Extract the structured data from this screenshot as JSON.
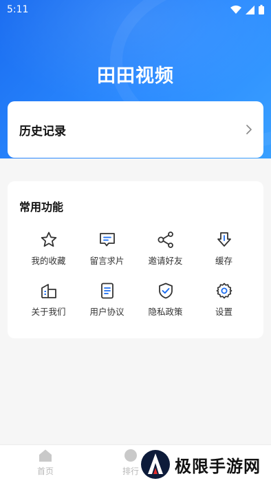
{
  "status_bar": {
    "time": "5:11"
  },
  "header": {
    "title": "田田视频"
  },
  "history": {
    "label": "历史记录"
  },
  "functions": {
    "title": "常用功能",
    "items": [
      {
        "label": "我的收藏",
        "icon": "star-icon"
      },
      {
        "label": "留言求片",
        "icon": "message-icon"
      },
      {
        "label": "邀请好友",
        "icon": "share-icon"
      },
      {
        "label": "缓存",
        "icon": "download-icon"
      },
      {
        "label": "关于我们",
        "icon": "building-icon"
      },
      {
        "label": "用户协议",
        "icon": "document-icon"
      },
      {
        "label": "隐私政策",
        "icon": "shield-check-icon"
      },
      {
        "label": "设置",
        "icon": "gear-icon"
      }
    ]
  },
  "tabbar": {
    "tabs": [
      {
        "label": "首页",
        "icon": "home-icon"
      },
      {
        "label": "排行",
        "icon": "ranking-icon"
      }
    ]
  },
  "watermark": {
    "text": "极限手游网"
  },
  "colors": {
    "primary": "#1a6cf0",
    "icon_stroke": "#333333",
    "tab_inactive": "#b9b9b9"
  }
}
